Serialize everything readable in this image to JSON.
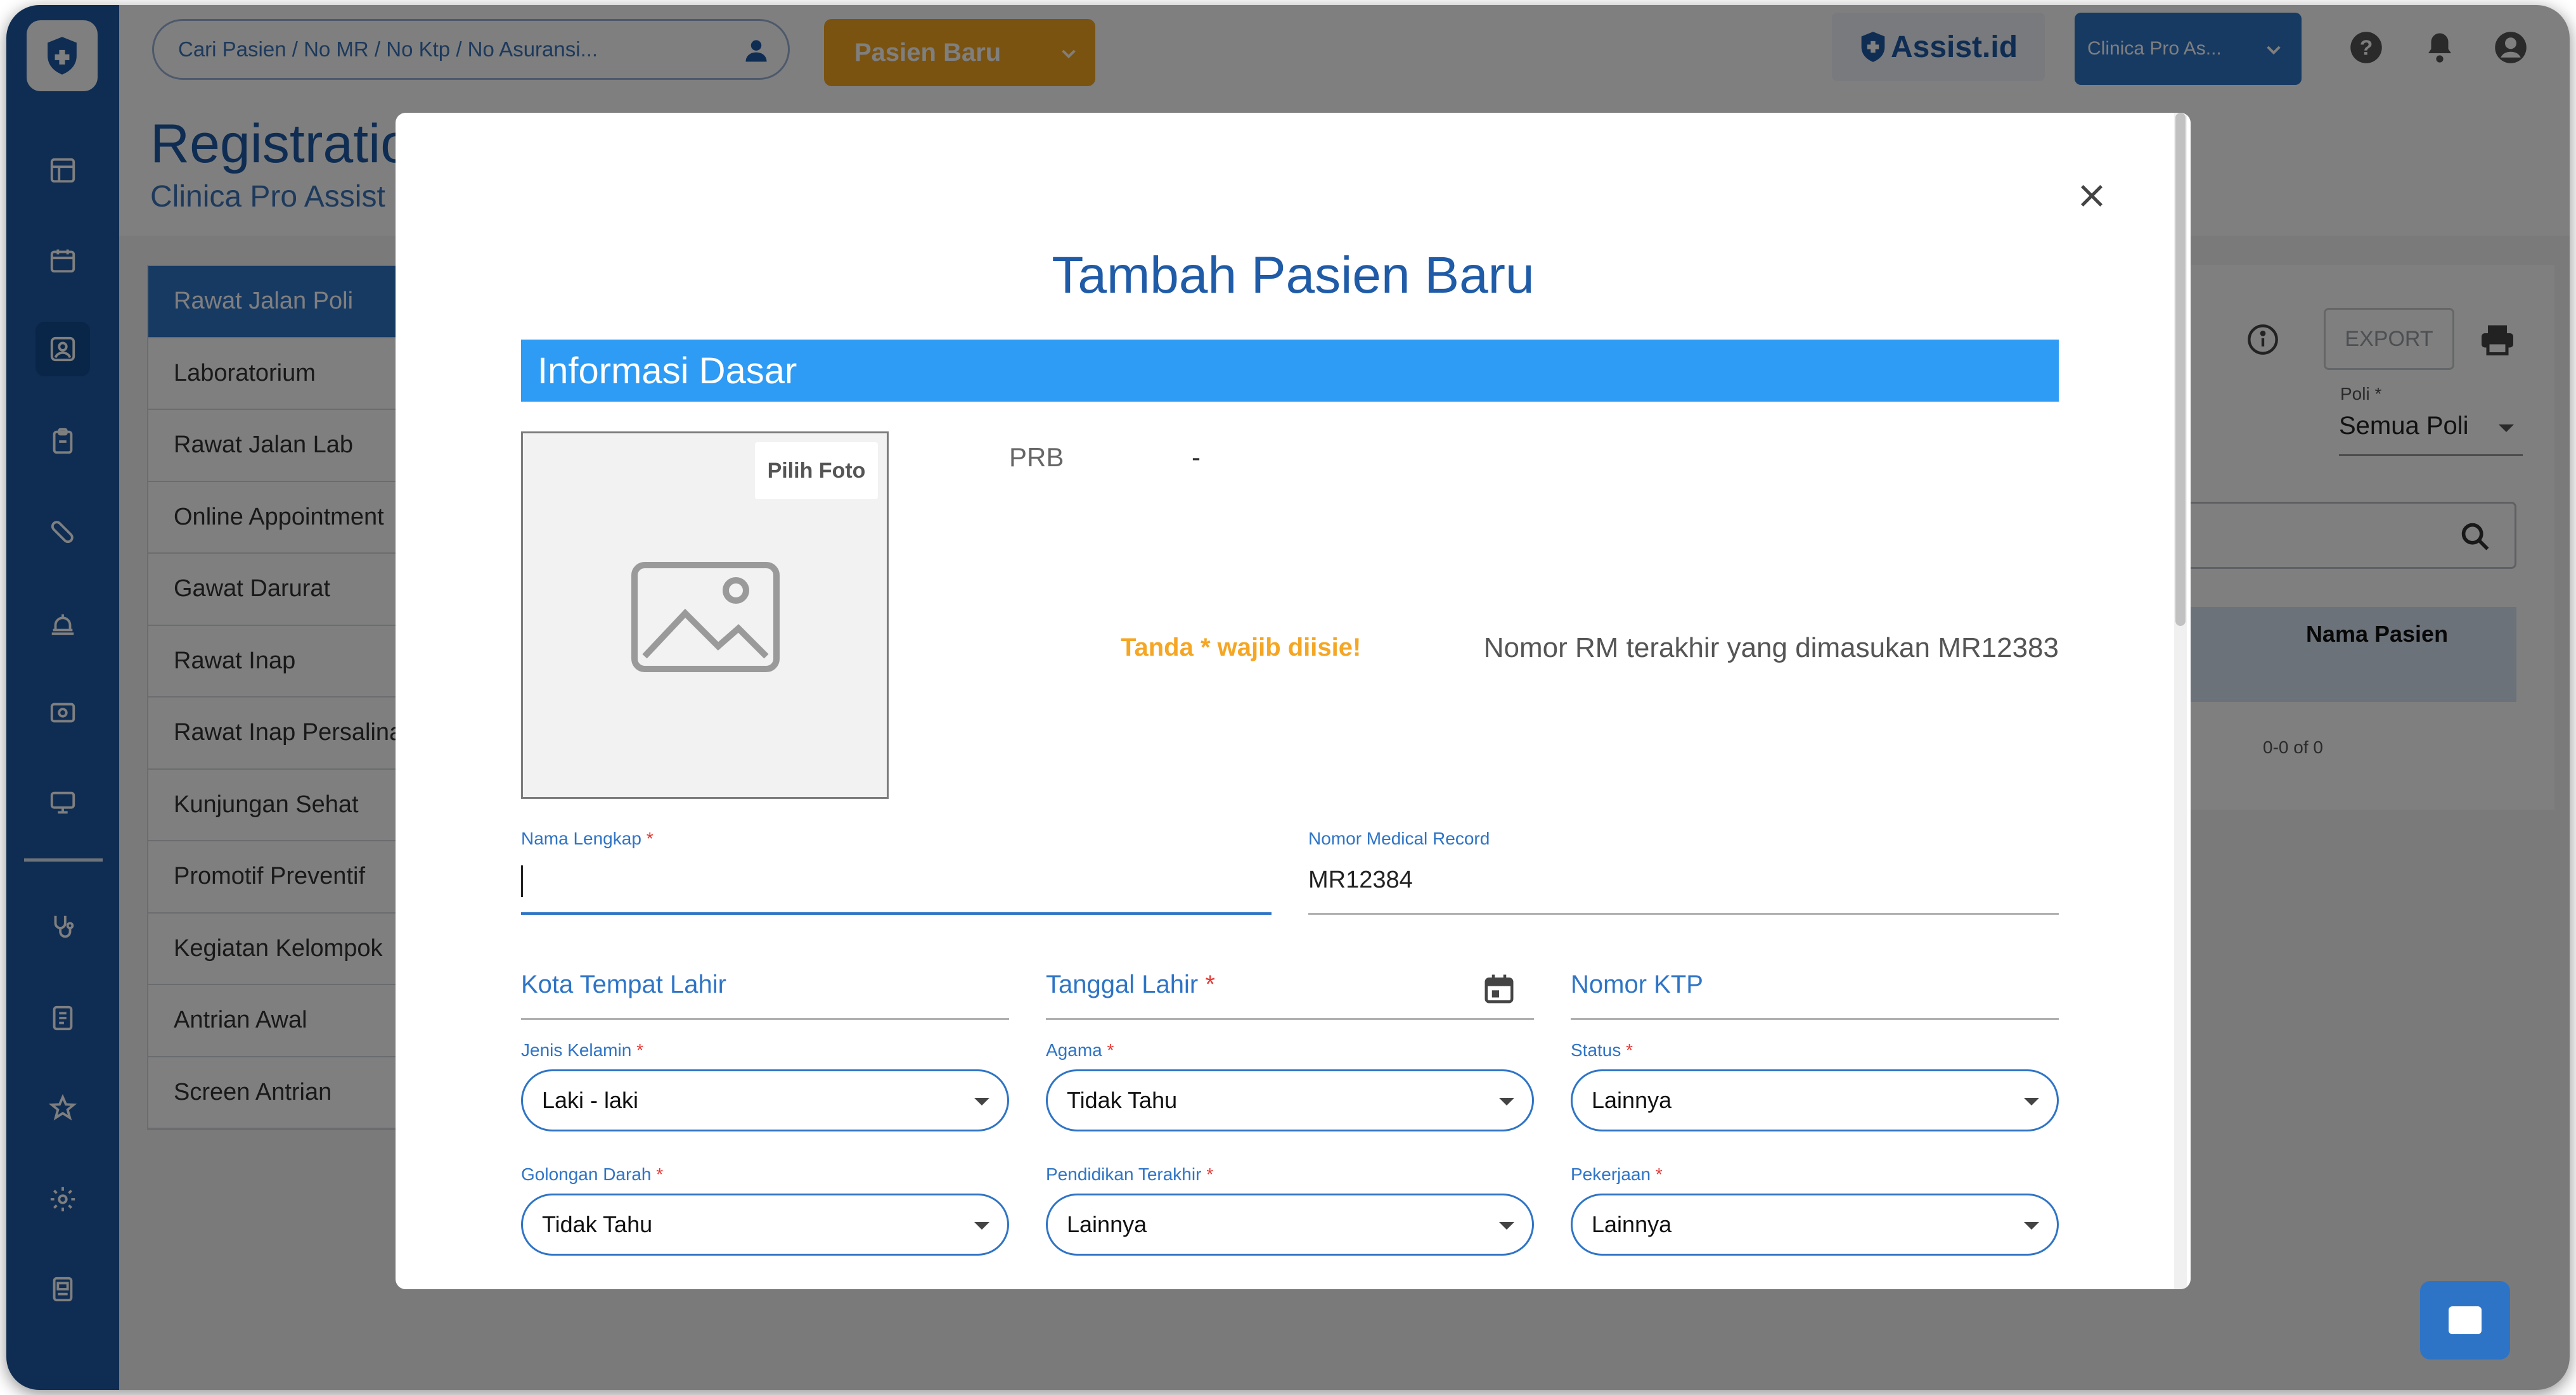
{
  "topbar": {
    "search_placeholder": "Cari Pasien / No MR / No Ktp / No Asuransi...",
    "new_patient_button": "Pasien Baru",
    "brand_logo": "Assist.id",
    "clinic_selector": "Clinica Pro As...",
    "icons": [
      "help-icon",
      "bell-icon",
      "account-icon"
    ]
  },
  "page": {
    "title": "Registratio",
    "subtitle": "Clinica Pro Assist"
  },
  "sidebar": {
    "icons": [
      "dashboard-icon",
      "calendar-icon",
      "registration-icon",
      "clipboard-icon",
      "pill-icon",
      "bell-service-icon",
      "billing-icon",
      "monitor-icon",
      "stethoscope-icon",
      "document-icon",
      "star-icon",
      "settings-icon",
      "report-icon"
    ]
  },
  "menu": {
    "items": [
      {
        "label": "Rawat Jalan Poli",
        "active": true
      },
      {
        "label": "Laboratorium"
      },
      {
        "label": "Rawat Jalan Lab"
      },
      {
        "label": "Online Appointment"
      },
      {
        "label": "Gawat Darurat"
      },
      {
        "label": "Rawat Inap"
      },
      {
        "label": "Rawat Inap Persalinan"
      },
      {
        "label": "Kunjungan Sehat"
      },
      {
        "label": "Promotif Preventif"
      },
      {
        "label": "Kegiatan Kelompok"
      },
      {
        "label": "Antrian Awal"
      },
      {
        "label": "Screen Antrian"
      }
    ]
  },
  "right_panel": {
    "export_label": "EXPORT",
    "poli_label": "Poli *",
    "poli_value": "Semua Poli",
    "column_header": "Nama Pasien",
    "pager_text": "0-0 of 0"
  },
  "modal": {
    "title": "Tambah Pasien Baru",
    "section_title": "Informasi Dasar",
    "photo_button": "Pilih Foto",
    "prb_label": "PRB",
    "prb_value": "-",
    "required_note": "Tanda * wajib diisie!",
    "last_rm_note": "Nomor RM terakhir yang dimasukan MR12383",
    "fields": {
      "nama_lengkap": {
        "label": "Nama Lengkap",
        "required": "*",
        "value": ""
      },
      "nomor_mr": {
        "label": "Nomor Medical Record",
        "value": "MR12384"
      },
      "kota_tempat_lahir": {
        "label": "Kota Tempat Lahir"
      },
      "tanggal_lahir": {
        "label": "Tanggal Lahir",
        "required": "*"
      },
      "nomor_ktp": {
        "label": "Nomor KTP"
      },
      "jenis_kelamin": {
        "label": "Jenis Kelamin",
        "required": "*",
        "value": "Laki - laki"
      },
      "agama": {
        "label": "Agama",
        "required": "*",
        "value": "Tidak Tahu"
      },
      "status": {
        "label": "Status",
        "required": "*",
        "value": "Lainnya"
      },
      "golongan_darah": {
        "label": "Golongan Darah",
        "required": "*",
        "value": "Tidak Tahu"
      },
      "pendidikan_terakhir": {
        "label": "Pendidikan Terakhir",
        "required": "*",
        "value": "Lainnya"
      },
      "pekerjaan": {
        "label": "Pekerjaan",
        "required": "*",
        "value": "Lainnya"
      }
    }
  },
  "colors": {
    "primary": "#1f5ba7",
    "accent": "#2e74c6",
    "section_bar": "#2e9bf5",
    "warning": "#f5a623",
    "required": "#e53935"
  }
}
